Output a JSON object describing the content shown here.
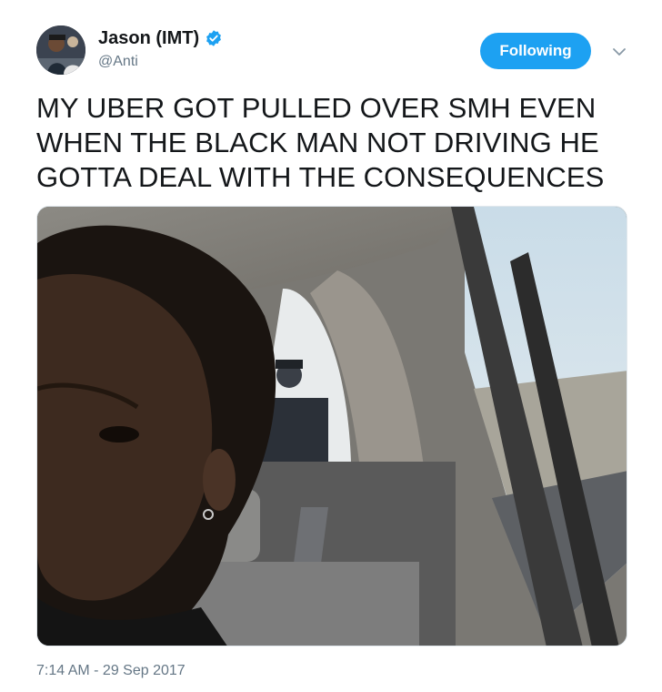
{
  "tweet": {
    "author": {
      "display_name": "Jason (IMT)",
      "handle": "@Anti",
      "verified": true,
      "avatar_icon": "avatar-photo"
    },
    "follow_button_label": "Following",
    "menu_icon": "chevron-down-icon",
    "text_lines": [
      "MY UBER GOT PULLED OVER SMH EVEN",
      "WHEN THE BLACK MAN NOT DRIVING HE",
      "GOTTA DEAL WITH THE CONSEQUENCES"
    ],
    "timestamp": "7:14 AM - 29 Sep 2017"
  },
  "colors": {
    "accent": "#1da1f2",
    "text_primary": "#14171a",
    "text_secondary": "#657786"
  }
}
